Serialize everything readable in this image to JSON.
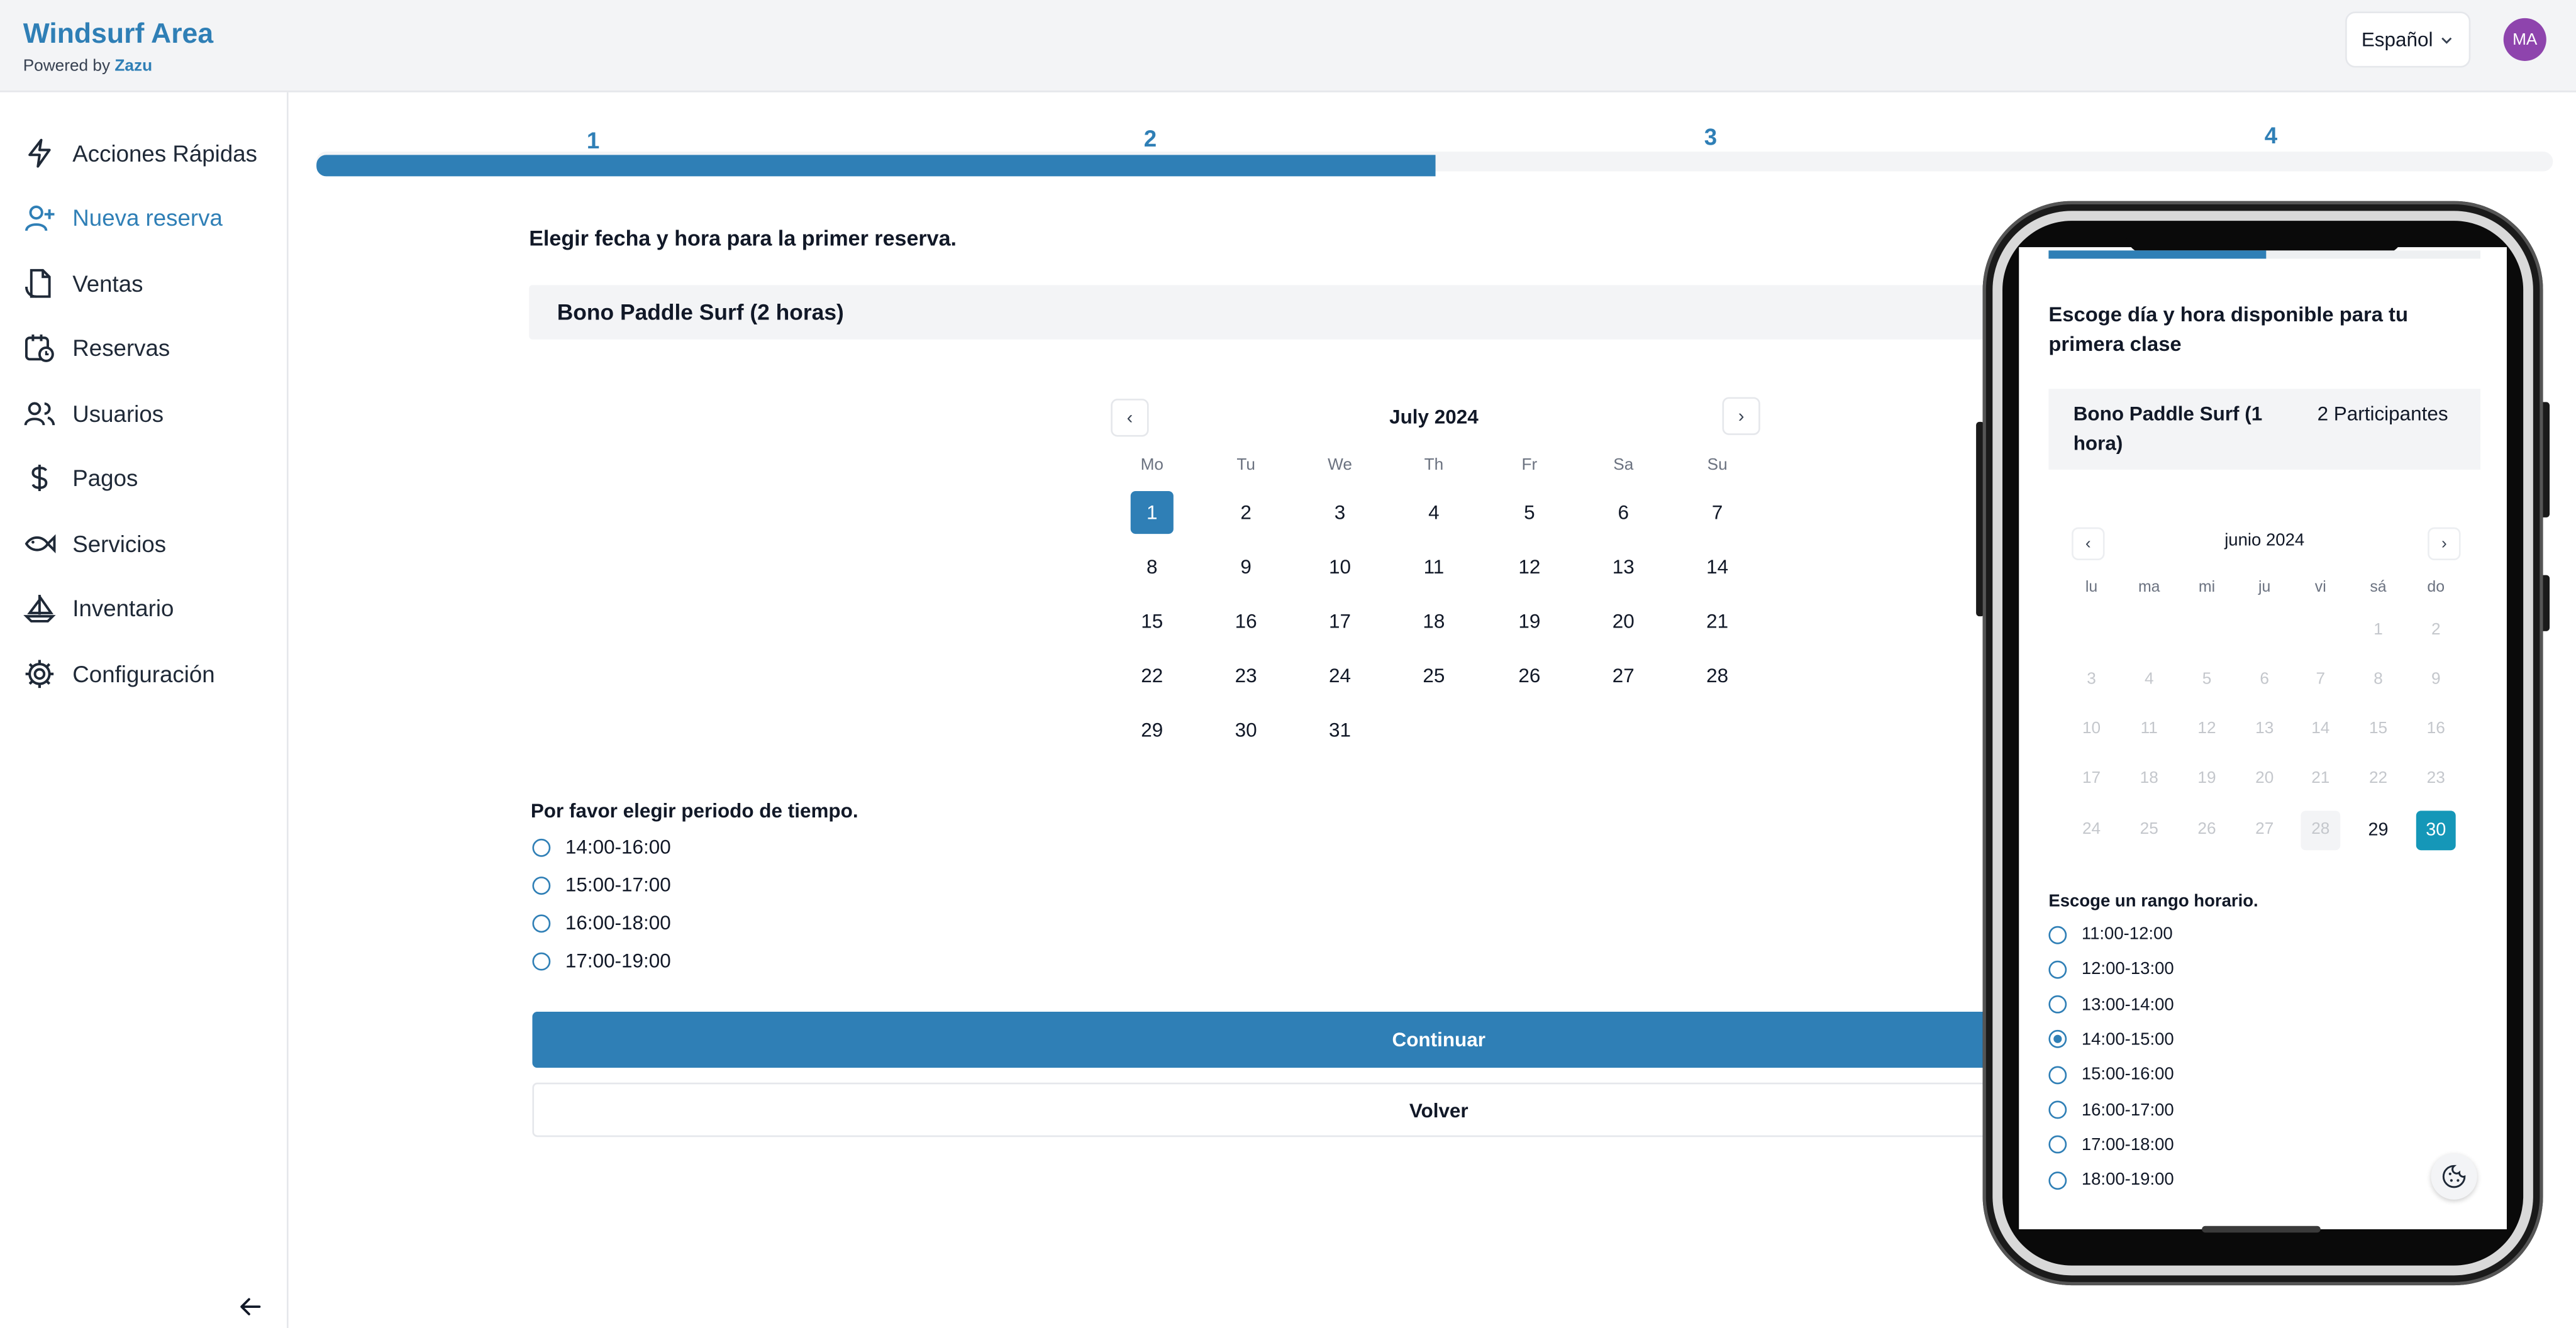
{
  "header": {
    "brand_title": "Windsurf Area",
    "brand_powered": "Powered by",
    "brand_company": "Zazu",
    "language": "Español",
    "avatar_initials": "MA"
  },
  "sidebar": {
    "items": [
      {
        "label": "Acciones Rápidas",
        "icon": "lightning-icon"
      },
      {
        "label": "Nueva reserva",
        "icon": "user-plus-icon",
        "active": true
      },
      {
        "label": "Ventas",
        "icon": "receipt-icon"
      },
      {
        "label": "Reservas",
        "icon": "calendar-clock-icon"
      },
      {
        "label": "Usuarios",
        "icon": "users-icon"
      },
      {
        "label": "Pagos",
        "icon": "dollar-icon"
      },
      {
        "label": "Servicios",
        "icon": "fish-icon"
      },
      {
        "label": "Inventario",
        "icon": "sailboat-icon"
      },
      {
        "label": "Configuración",
        "icon": "gear-icon"
      }
    ]
  },
  "stepper": {
    "steps": [
      "1",
      "2",
      "3",
      "4"
    ],
    "progress": 0.5
  },
  "main": {
    "instruction": "Elegir fecha y hora para la primer reserva.",
    "service_name": "Bono Paddle Surf (2 horas)",
    "calendar": {
      "month": "July 2024",
      "weekdays": [
        "Mo",
        "Tu",
        "We",
        "Th",
        "Fr",
        "Sa",
        "Su"
      ],
      "weeks": [
        [
          "1",
          "2",
          "3",
          "4",
          "5",
          "6",
          "7"
        ],
        [
          "8",
          "9",
          "10",
          "11",
          "12",
          "13",
          "14"
        ],
        [
          "15",
          "16",
          "17",
          "18",
          "19",
          "20",
          "21"
        ],
        [
          "22",
          "23",
          "24",
          "25",
          "26",
          "27",
          "28"
        ],
        [
          "29",
          "30",
          "31",
          "",
          "",
          "",
          ""
        ]
      ],
      "selected": "1"
    },
    "period_label": "Por favor elegir periodo de tiempo.",
    "periods": [
      "14:00-16:00",
      "15:00-17:00",
      "16:00-18:00",
      "17:00-19:00"
    ],
    "continue_label": "Continuar",
    "back_label": "Volver"
  },
  "mobile": {
    "title": "Escoge día y hora disponible para tu primera clase",
    "service_name": "Bono Paddle Surf (1 hora)",
    "participants": "2 Participantes",
    "calendar": {
      "month": "junio 2024",
      "weekdays": [
        "lu",
        "ma",
        "mi",
        "ju",
        "vi",
        "sá",
        "do"
      ],
      "weeks": [
        [
          "",
          "",
          "",
          "",
          "",
          "1",
          "2"
        ],
        [
          "3",
          "4",
          "5",
          "6",
          "7",
          "8",
          "9"
        ],
        [
          "10",
          "11",
          "12",
          "13",
          "14",
          "15",
          "16"
        ],
        [
          "17",
          "18",
          "19",
          "20",
          "21",
          "22",
          "23"
        ],
        [
          "24",
          "25",
          "26",
          "27",
          "28",
          "29",
          "30"
        ]
      ],
      "available": [
        "29"
      ],
      "muted": [
        "28"
      ],
      "selected": "30"
    },
    "range_label": "Escoge un rango horario.",
    "ranges": [
      "11:00-12:00",
      "12:00-13:00",
      "13:00-14:00",
      "14:00-15:00",
      "15:00-16:00",
      "16:00-17:00",
      "17:00-18:00",
      "18:00-19:00"
    ],
    "checked_range": "14:00-15:00"
  },
  "colors": {
    "accent": "#2f7fb6",
    "mobile_selected": "#1597b8",
    "avatar": "#8e44ad"
  }
}
